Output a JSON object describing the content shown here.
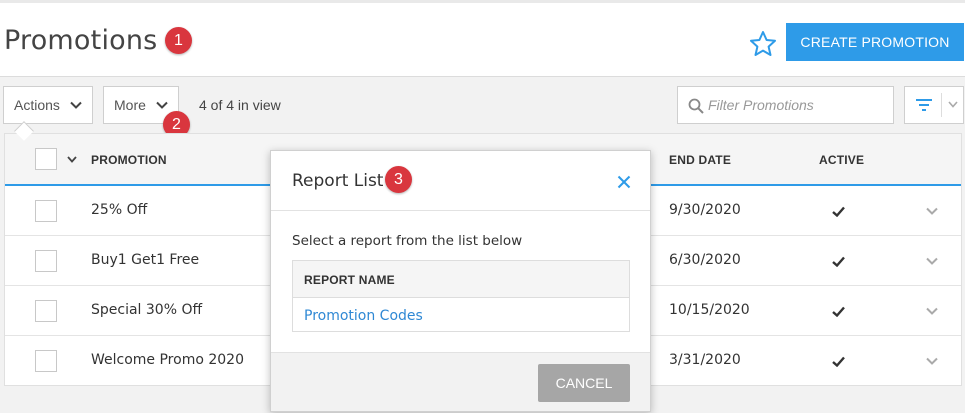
{
  "header": {
    "title": "Promotions",
    "create_label": "CREATE PROMOTION",
    "accent": "#2e9be8"
  },
  "badges": [
    "1",
    "2",
    "3"
  ],
  "toolbar": {
    "actions_label": "Actions",
    "more_label": "More",
    "in_view": "4 of 4 in view",
    "filter_placeholder": "Filter Promotions"
  },
  "table": {
    "columns": {
      "promotion": "PROMOTION",
      "end_date": "END DATE",
      "active": "ACTIVE"
    },
    "rows": [
      {
        "name": "25% Off",
        "end_date": "9/30/2020",
        "active": true
      },
      {
        "name": "Buy1 Get1 Free",
        "end_date": "6/30/2020",
        "active": true
      },
      {
        "name": "Special 30% Off",
        "end_date": "10/15/2020",
        "active": true
      },
      {
        "name": "Welcome Promo 2020",
        "end_date": "3/31/2020",
        "active": true
      }
    ]
  },
  "modal": {
    "title": "Report List",
    "description": "Select a report from the list below",
    "column_header": "REPORT NAME",
    "reports": [
      "Promotion Codes"
    ],
    "cancel_label": "CANCEL"
  },
  "icons": {
    "favorite": "star-icon",
    "search": "search-icon",
    "filter": "filter-icon",
    "close": "close-icon",
    "chevron": "chevron-down-icon",
    "check": "checkmark-icon"
  }
}
